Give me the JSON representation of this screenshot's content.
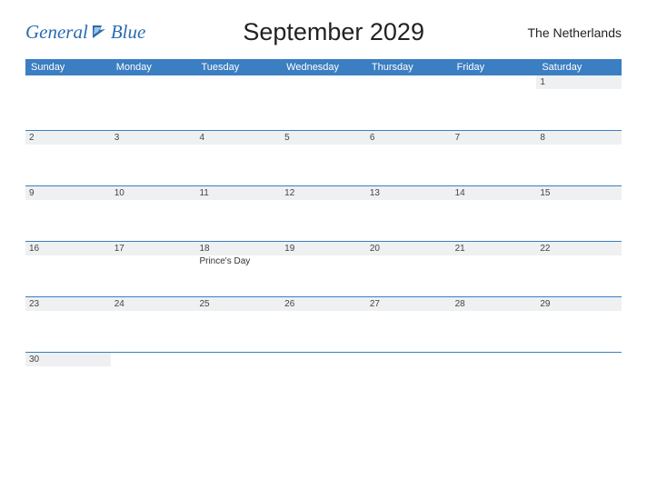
{
  "header": {
    "logo_general": "General",
    "logo_blue": "Blue",
    "title": "September 2029",
    "region": "The Netherlands"
  },
  "dayheads": [
    "Sunday",
    "Monday",
    "Tuesday",
    "Wednesday",
    "Thursday",
    "Friday",
    "Saturday"
  ],
  "weeks": [
    [
      {
        "num": "",
        "event": ""
      },
      {
        "num": "",
        "event": ""
      },
      {
        "num": "",
        "event": ""
      },
      {
        "num": "",
        "event": ""
      },
      {
        "num": "",
        "event": ""
      },
      {
        "num": "",
        "event": ""
      },
      {
        "num": "1",
        "event": ""
      }
    ],
    [
      {
        "num": "2",
        "event": ""
      },
      {
        "num": "3",
        "event": ""
      },
      {
        "num": "4",
        "event": ""
      },
      {
        "num": "5",
        "event": ""
      },
      {
        "num": "6",
        "event": ""
      },
      {
        "num": "7",
        "event": ""
      },
      {
        "num": "8",
        "event": ""
      }
    ],
    [
      {
        "num": "9",
        "event": ""
      },
      {
        "num": "10",
        "event": ""
      },
      {
        "num": "11",
        "event": ""
      },
      {
        "num": "12",
        "event": ""
      },
      {
        "num": "13",
        "event": ""
      },
      {
        "num": "14",
        "event": ""
      },
      {
        "num": "15",
        "event": ""
      }
    ],
    [
      {
        "num": "16",
        "event": ""
      },
      {
        "num": "17",
        "event": ""
      },
      {
        "num": "18",
        "event": "Prince's Day"
      },
      {
        "num": "19",
        "event": ""
      },
      {
        "num": "20",
        "event": ""
      },
      {
        "num": "21",
        "event": ""
      },
      {
        "num": "22",
        "event": ""
      }
    ],
    [
      {
        "num": "23",
        "event": ""
      },
      {
        "num": "24",
        "event": ""
      },
      {
        "num": "25",
        "event": ""
      },
      {
        "num": "26",
        "event": ""
      },
      {
        "num": "27",
        "event": ""
      },
      {
        "num": "28",
        "event": ""
      },
      {
        "num": "29",
        "event": ""
      }
    ],
    [
      {
        "num": "30",
        "event": ""
      },
      {
        "num": "",
        "event": ""
      },
      {
        "num": "",
        "event": ""
      },
      {
        "num": "",
        "event": ""
      },
      {
        "num": "",
        "event": ""
      },
      {
        "num": "",
        "event": ""
      },
      {
        "num": "",
        "event": ""
      }
    ]
  ]
}
